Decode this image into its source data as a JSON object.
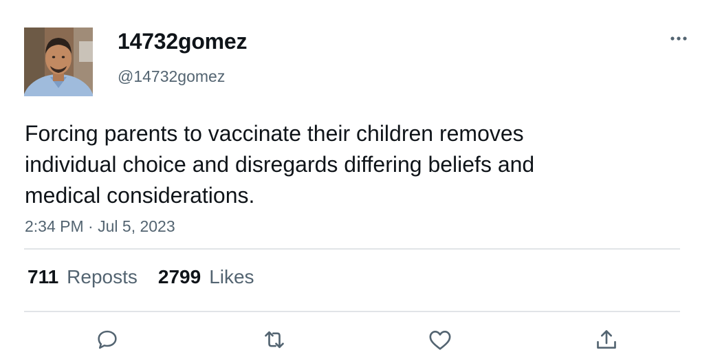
{
  "user": {
    "display_name": "14732gomez",
    "handle": "@14732gomez"
  },
  "tweet": {
    "text_lines": [
      "Forcing parents to vaccinate their children removes",
      "individual choice and disregards differing beliefs and",
      "medical considerations."
    ],
    "time": "2:34 PM",
    "separator": "·",
    "date": "Jul 5, 2023"
  },
  "stats": {
    "reposts_count": "711",
    "reposts_label": "Reposts",
    "likes_count": "2799",
    "likes_label": "Likes"
  },
  "icons": {
    "more": "more-horizontal-icon",
    "reply": "reply-icon",
    "repost": "repost-icon",
    "like": "heart-icon",
    "share": "share-icon"
  },
  "colors": {
    "text": "#0f1419",
    "secondary": "#536471",
    "divider": "#e1e4e7"
  }
}
